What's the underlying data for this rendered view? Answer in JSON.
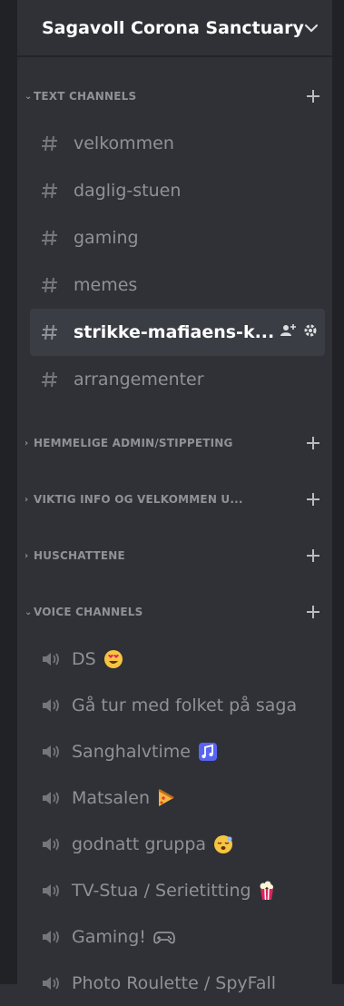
{
  "server": {
    "name": "Sagavoll Corona Sanctuary"
  },
  "categories": {
    "text": {
      "label": "TEXT CHANNELS"
    },
    "hemmelige": {
      "label": "HEMMELIGE ADMIN/STIPPETING"
    },
    "viktig": {
      "label": "VIKTIG INFO OG VELKOMMEN U..."
    },
    "huschattene": {
      "label": "HUSCHATTENE"
    },
    "voice": {
      "label": "VOICE CHANNELS"
    }
  },
  "text_channels": [
    {
      "label": "velkommen"
    },
    {
      "label": "daglig-stuen"
    },
    {
      "label": "gaming"
    },
    {
      "label": "memes"
    },
    {
      "label": "strikke-mafiaens-k...",
      "selected": true
    },
    {
      "label": "arrangementer"
    }
  ],
  "voice_channels": [
    {
      "label": "DS",
      "emoji": "heart-eyes-emoji"
    },
    {
      "label": "Gå tur med folket på saga"
    },
    {
      "label": "Sanghalvtime",
      "emoji": "music-notes-emoji"
    },
    {
      "label": "Matsalen",
      "emoji": "pizza-emoji"
    },
    {
      "label": "godnatt gruppa",
      "emoji": "sleeping-face-emoji"
    },
    {
      "label": "TV-Stua / Serietitting",
      "emoji": "popcorn-emoji"
    },
    {
      "label": "Gaming!",
      "emoji": "game-controller-emoji"
    },
    {
      "label": "Photo Roulette / SpyFall"
    }
  ],
  "colors": {
    "sidebar_bg": "#2f3136",
    "frame_bg": "#202225",
    "muted_text": "#8e9297",
    "active_text": "#ffffff",
    "selected_bg": "#3a3d43"
  }
}
